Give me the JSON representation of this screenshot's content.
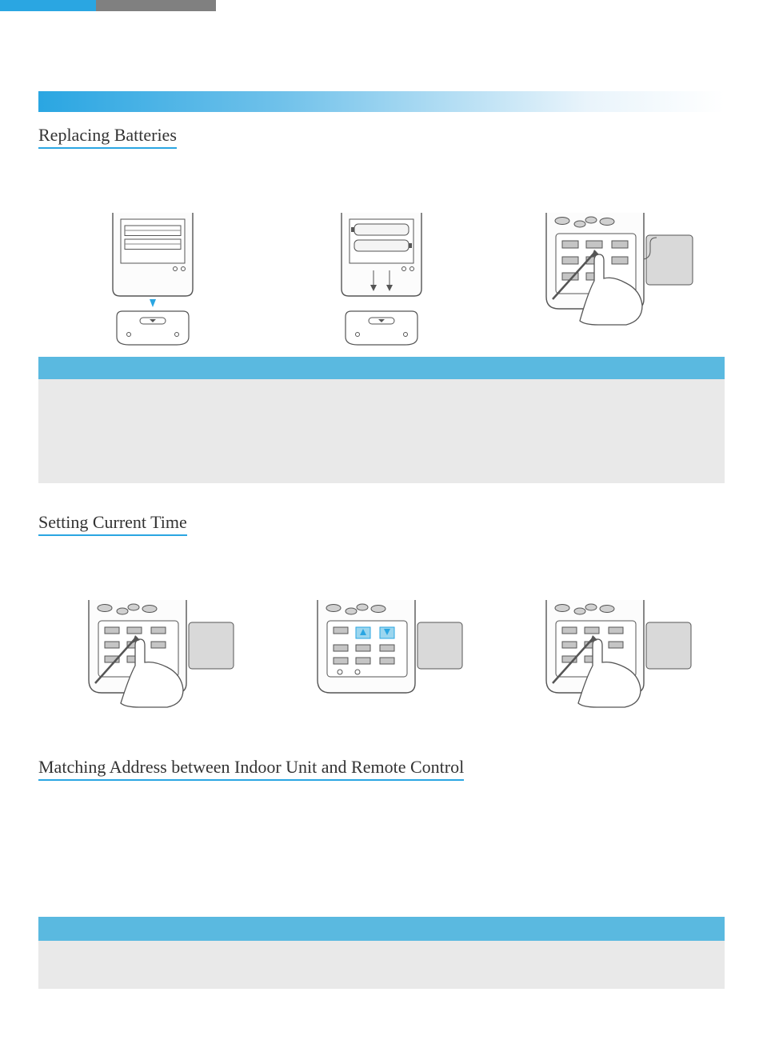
{
  "section1": {
    "heading": "Replacing Batteries"
  },
  "section2": {
    "heading": "Setting Current Time"
  },
  "section3": {
    "heading": "Matching Address between Indoor Unit and Remote Control"
  },
  "illustrations": {
    "remote_back_open": "remote-battery-cover-open",
    "remote_insert_batteries": "remote-insert-batteries",
    "remote_press_button": "remote-front-press-button",
    "remote_time_step1": "remote-set-time-step1",
    "remote_time_step2": "remote-set-time-step2",
    "remote_time_step3": "remote-set-time-step3"
  }
}
